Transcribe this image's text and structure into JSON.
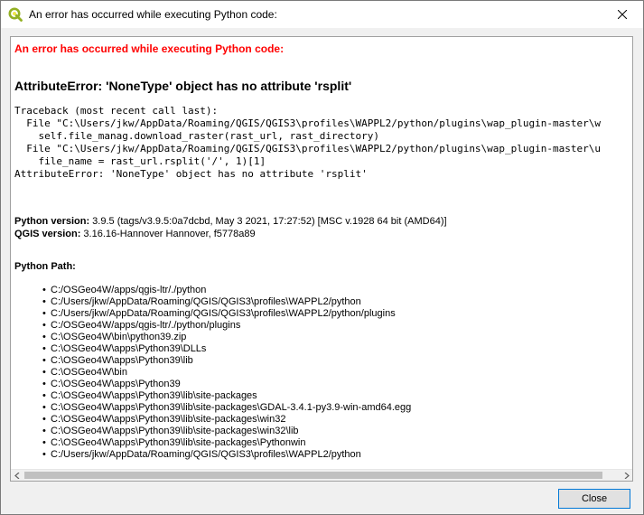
{
  "window": {
    "title": "An error has occurred while executing Python code:"
  },
  "content": {
    "error_heading": "An error has occurred while executing Python code:",
    "error_title": "AttributeError: 'NoneType' object has no attribute 'rsplit'",
    "traceback": "Traceback (most recent call last):\n  File \"C:\\Users/jkw/AppData/Roaming/QGIS/QGIS3\\profiles\\WAPPL2/python/plugins\\wap_plugin-master\\w\n    self.file_manag.download_raster(rast_url, rast_directory)\n  File \"C:\\Users/jkw/AppData/Roaming/QGIS/QGIS3\\profiles\\WAPPL2/python/plugins\\wap_plugin-master\\u\n    file_name = rast_url.rsplit('/', 1)[1]\nAttributeError: 'NoneType' object has no attribute 'rsplit'",
    "python_version_label": "Python version:",
    "python_version_value": " 3.9.5 (tags/v3.9.5:0a7dcbd, May  3 2021, 17:27:52) [MSC v.1928 64 bit (AMD64)]",
    "qgis_version_label": "QGIS version:",
    "qgis_version_value": " 3.16.16-Hannover Hannover, f5778a89",
    "python_path_label": "Python Path:",
    "paths": [
      "C:/OSGeo4W/apps/qgis-ltr/./python",
      "C:/Users/jkw/AppData/Roaming/QGIS/QGIS3\\profiles\\WAPPL2/python",
      "C:/Users/jkw/AppData/Roaming/QGIS/QGIS3\\profiles\\WAPPL2/python/plugins",
      "C:/OSGeo4W/apps/qgis-ltr/./python/plugins",
      "C:\\OSGeo4W\\bin\\python39.zip",
      "C:\\OSGeo4W\\apps\\Python39\\DLLs",
      "C:\\OSGeo4W\\apps\\Python39\\lib",
      "C:\\OSGeo4W\\bin",
      "C:\\OSGeo4W\\apps\\Python39",
      "C:\\OSGeo4W\\apps\\Python39\\lib\\site-packages",
      "C:\\OSGeo4W\\apps\\Python39\\lib\\site-packages\\GDAL-3.4.1-py3.9-win-amd64.egg",
      "C:\\OSGeo4W\\apps\\Python39\\lib\\site-packages\\win32",
      "C:\\OSGeo4W\\apps\\Python39\\lib\\site-packages\\win32\\lib",
      "C:\\OSGeo4W\\apps\\Python39\\lib\\site-packages\\Pythonwin",
      "C:/Users/jkw/AppData/Roaming/QGIS/QGIS3\\profiles\\WAPPL2/python"
    ]
  },
  "buttons": {
    "close_label": "Close"
  },
  "colors": {
    "error_red": "#ff0000",
    "qgis_green": "#93b023",
    "qgis_yellow": "#f0e64a",
    "focus_blue": "#0078d7"
  },
  "icons": {
    "app": "qgis-logo-icon",
    "window_close": "close-icon",
    "scroll_left": "arrow-left-icon",
    "scroll_right": "arrow-right-icon"
  }
}
